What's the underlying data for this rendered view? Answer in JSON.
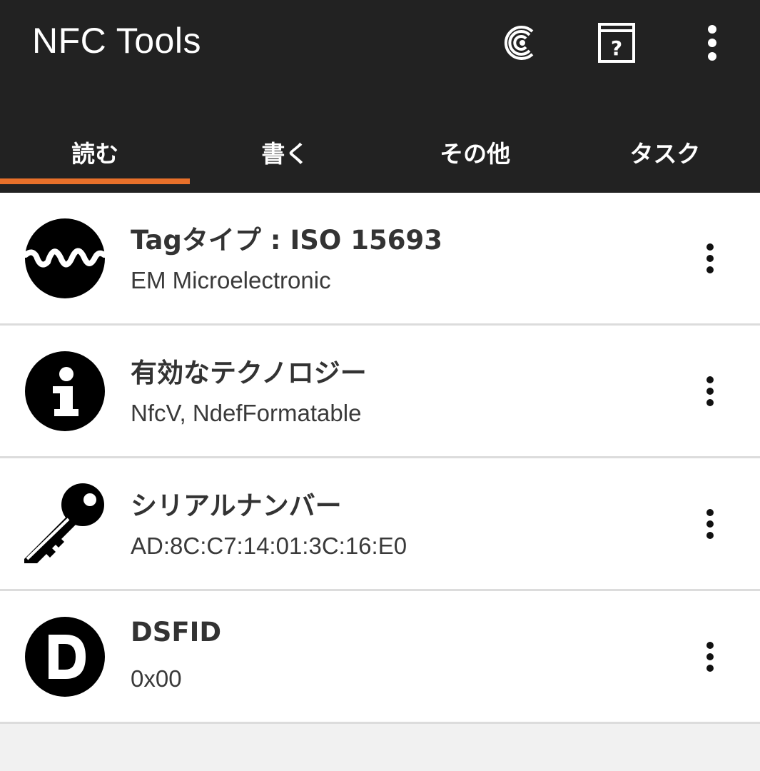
{
  "app": {
    "title": "NFC Tools",
    "actions": {
      "coin_icon": "coin-c-icon",
      "help_icon": "help-book-icon",
      "overflow_icon": "more-vertical-icon"
    }
  },
  "colors": {
    "appbar_bg": "#222222",
    "accent": "#e8702a",
    "list_bg": "#ffffff",
    "page_bg": "#f1f1f1"
  },
  "tabs": [
    {
      "label": "読む",
      "selected": true
    },
    {
      "label": "書く",
      "selected": false
    },
    {
      "label": "その他",
      "selected": false
    },
    {
      "label": "タスク",
      "selected": false
    }
  ],
  "items": [
    {
      "icon": "waveform-icon",
      "title": "Tagタイプ : ISO 15693",
      "subtitle": "EM Microelectronic"
    },
    {
      "icon": "info-icon",
      "title": "有効なテクノロジー",
      "subtitle": "NfcV, NdefFormatable"
    },
    {
      "icon": "key-icon",
      "title": "シリアルナンバー",
      "subtitle": "AD:8C:C7:14:01:3C:16:E0"
    },
    {
      "icon": "letter-d-icon",
      "title": "DSFID",
      "subtitle": "0x00"
    }
  ]
}
